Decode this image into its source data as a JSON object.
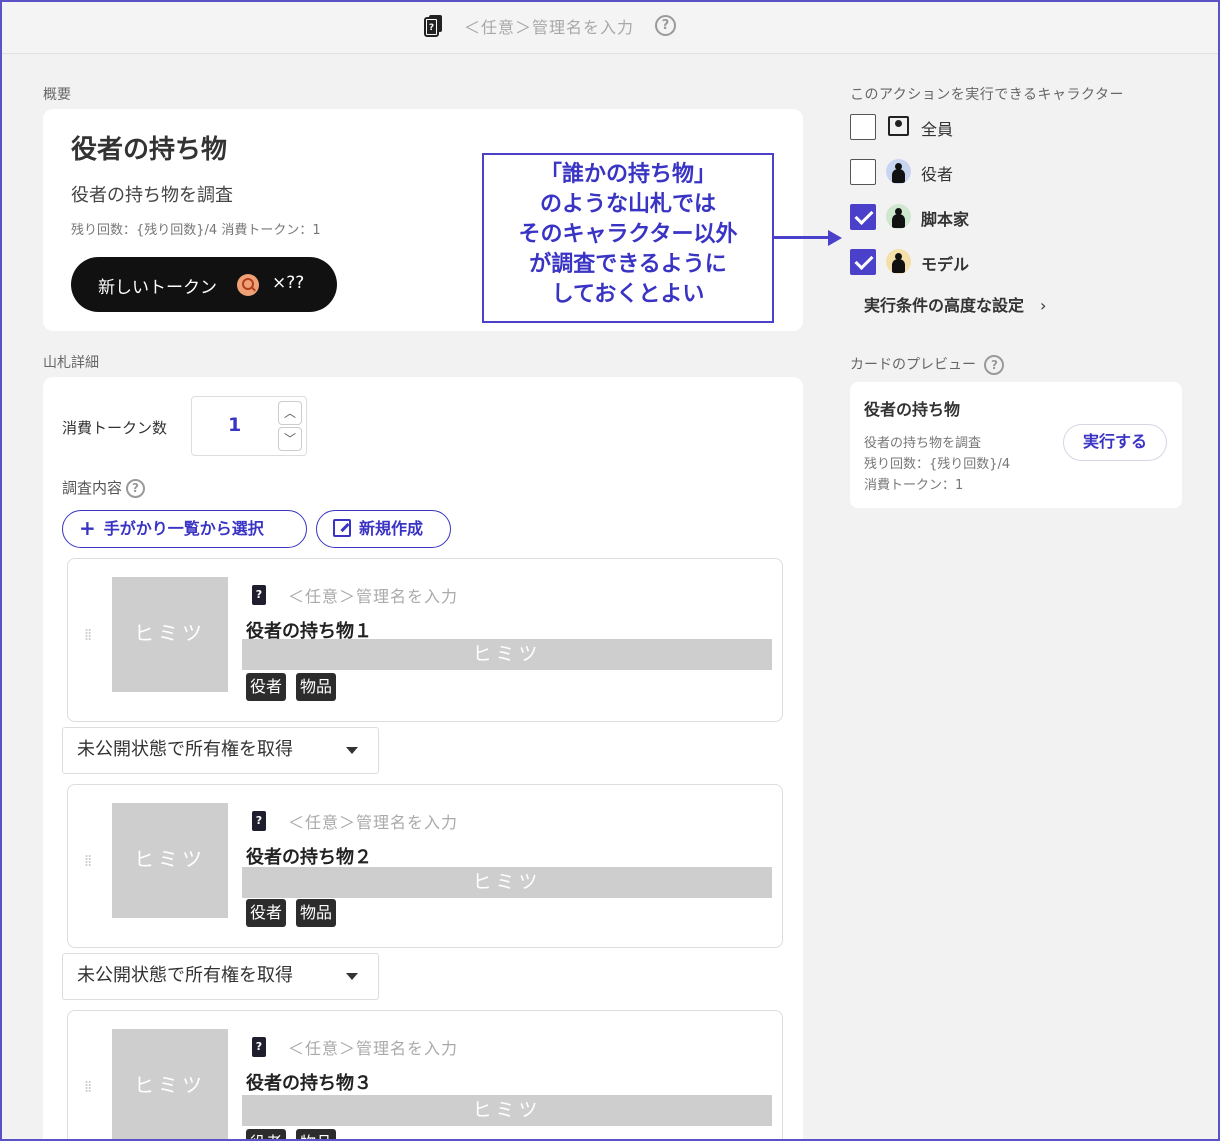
{
  "header": {
    "name_placeholder": "＜任意＞管理名を入力",
    "help": "?"
  },
  "overview": {
    "section_label": "概要",
    "title": "役者の持ち物",
    "subtitle": "役者の持ち物を調査",
    "meta": "残り回数：{残り回数}/4 消費トークン：1",
    "token_button": {
      "label": "新しいトークン",
      "count": "×??"
    }
  },
  "annotation": {
    "lines": [
      "「誰かの持ち物」",
      "のような山札では",
      "そのキャラクター以外",
      "が調査できるように",
      "しておくとよい"
    ]
  },
  "deck": {
    "section_label": "山札詳細",
    "cost_label": "消費トークン数",
    "cost_value": "1",
    "investigation_label": "調査内容",
    "select_from_list_button": "手がかり一覧から選択",
    "new_button": "新規作成",
    "clues": [
      {
        "placeholder": "＜任意＞管理名を入力",
        "title": "役者の持ち物１",
        "thumb": "ヒミツ",
        "bar": "ヒミツ",
        "tags": [
          "役者",
          "物品"
        ],
        "dropdown": "未公開状態で所有権を取得"
      },
      {
        "placeholder": "＜任意＞管理名を入力",
        "title": "役者の持ち物２",
        "thumb": "ヒミツ",
        "bar": "ヒミツ",
        "tags": [
          "役者",
          "物品"
        ],
        "dropdown": "未公開状態で所有権を取得"
      },
      {
        "placeholder": "＜任意＞管理名を入力",
        "title": "役者の持ち物３",
        "thumb": "ヒミツ",
        "bar": "ヒミツ",
        "tags": [
          "役者",
          "物品"
        ]
      }
    ]
  },
  "characters": {
    "label": "このアクションを実行できるキャラクター",
    "items": [
      {
        "name": "全員",
        "checked": false,
        "icon": "book-user-icon"
      },
      {
        "name": "役者",
        "checked": false,
        "avatar_color": "#c9d4f0"
      },
      {
        "name": "脚本家",
        "checked": true,
        "avatar_color": "#cfe6cf"
      },
      {
        "name": "モデル",
        "checked": true,
        "avatar_color": "#f5dfa8"
      }
    ],
    "advanced": "実行条件の高度な設定"
  },
  "preview": {
    "label": "カードのプレビュー",
    "title": "役者の持ち物",
    "lines": [
      "役者の持ち物を調査",
      "残り回数：{残り回数}/4",
      "消費トークン：1"
    ],
    "run_button": "実行する"
  },
  "colors": {
    "accent": "#4a40c9",
    "annotation_border": "#4a40c9"
  }
}
